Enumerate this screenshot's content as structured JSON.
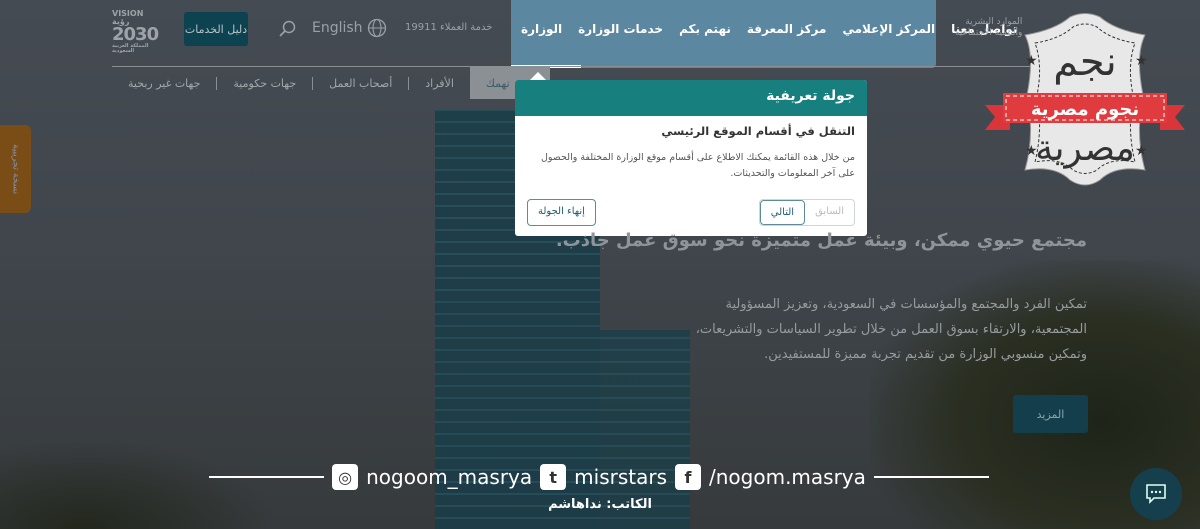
{
  "header": {
    "vision_logo": {
      "top": "VISION رؤية",
      "year": "2030",
      "sub": "المملكة العربية السعودية"
    },
    "services_guide": "دليل الخدمات",
    "language": "English",
    "customer_service": "خدمة العملاء 19911",
    "ministry_name": [
      "الموارد البشرية",
      "والتنمية الاجتماعية"
    ],
    "main_nav": [
      "الوزارة",
      "خدمات الوزارة",
      "نهتم بكم",
      "مركز المعرفة",
      "المركز الإعلامي",
      "تواصل معنا"
    ]
  },
  "sub_nav": {
    "active": "تهمك",
    "items": [
      "الأفراد",
      "أصحاب العمل",
      "جهات حكومية",
      "جهات غير ربحية"
    ]
  },
  "tour": {
    "title": "جولة تعريفية",
    "heading": "التنقل في أقسام الموقع الرئيسي",
    "body": "من خلال هذه القائمة يمكنك الاطلاع على أقسام موقع الوزارة المختلفة والحصول على آخر المعلومات والتحديثات.",
    "prev": "السابق",
    "next": "التالي",
    "end": "إنهاء الجولة"
  },
  "hero": {
    "heading": "مجتمع حيوي ممكن، وبيئة عمل متميزة نحو سوق عمل جاذب.",
    "lines": [
      "تمكين الفرد والمجتمع والمؤسسات في السعودية، وتعزيز المسؤولية",
      "المجتمعية، والارتقاء بسوق العمل من خلال تطوير السياسات والتشريعات،",
      "وتمكين منسوبي الوزارة من تقديم تجربة مميزة للمستفيدين."
    ],
    "more": "المزيد"
  },
  "beta_tab": "نسخة تجريبية",
  "watermark": {
    "text": "نجوم مصرية",
    "instagram": "nogoom_masrya",
    "twitter": "misrstars",
    "facebook": "/nogom.masrya",
    "writer": "الكاتب: نداهاشم"
  },
  "colors": {
    "teal": "#17807f",
    "nav_panel": "#5b87a0",
    "ribbon": "#e03b3f"
  }
}
